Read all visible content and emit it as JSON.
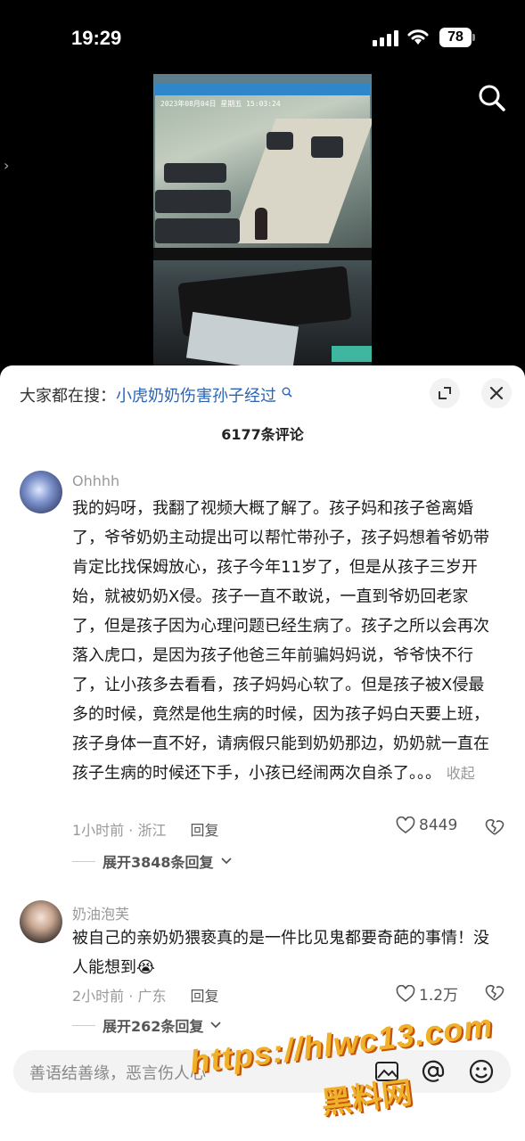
{
  "status_bar": {
    "time": "19:29",
    "battery": "78",
    "icons": [
      "signal-icon",
      "wifi-icon",
      "battery-icon"
    ]
  },
  "video": {
    "osd_text": "2023年08月04日 星期五 15:03:24",
    "icons": [
      "search-icon",
      "chevron-right-icon"
    ]
  },
  "sheet": {
    "hot_search_prefix": "大家都在搜：",
    "hot_search_keyword": "小虎奶奶伤害孙子经过",
    "comment_count": "6177条评论",
    "icons": [
      "expand-icon",
      "close-icon"
    ]
  },
  "comments": [
    {
      "username": "Ohhhh",
      "text": "我的妈呀，我翻了视频大概了解了。孩子妈和孩子爸离婚了，爷爷奶奶主动提出可以帮忙带孙子，孩子妈想着爷奶带肯定比找保姆放心，孩子今年11岁了，但是从孩子三岁开始，就被奶奶X侵。孩子一直不敢说，一直到爷奶回老家了，但是孩子因为心理问题已经生病了。孩子之所以会再次落入虎口，是因为孩子他爸三年前骗妈妈说，爷爷快不行了，让小孩多去看看，孩子妈妈心软了。但是孩子被X侵最多的时候，竟然是他生病的时候，因为孩子妈白天要上班，孩子身体一直不好，请病假只能到奶奶那边，奶奶就一直在孩子生病的时候还下手，小孩已经闹两次自杀了。。。",
      "collapse_label": "收起",
      "time_location": "1小时前 · 浙江",
      "reply_label": "回复",
      "likes": "8449",
      "expand_replies": "展开3848条回复"
    },
    {
      "username": "奶油泡芙",
      "text": "被自己的亲奶奶猥亵真的是一件比见鬼都要奇葩的事情！没人能想到😭",
      "time_location": "2小时前 · 广东",
      "reply_label": "回复",
      "likes": "1.2万",
      "expand_replies": "展开262条回复"
    }
  ],
  "input": {
    "placeholder": "善语结善缘，恶言伤人心",
    "icons": [
      "image-icon",
      "at-icon",
      "emoji-icon"
    ]
  },
  "watermark": {
    "url": "https://hlwc13.com",
    "name": "黑料网"
  }
}
